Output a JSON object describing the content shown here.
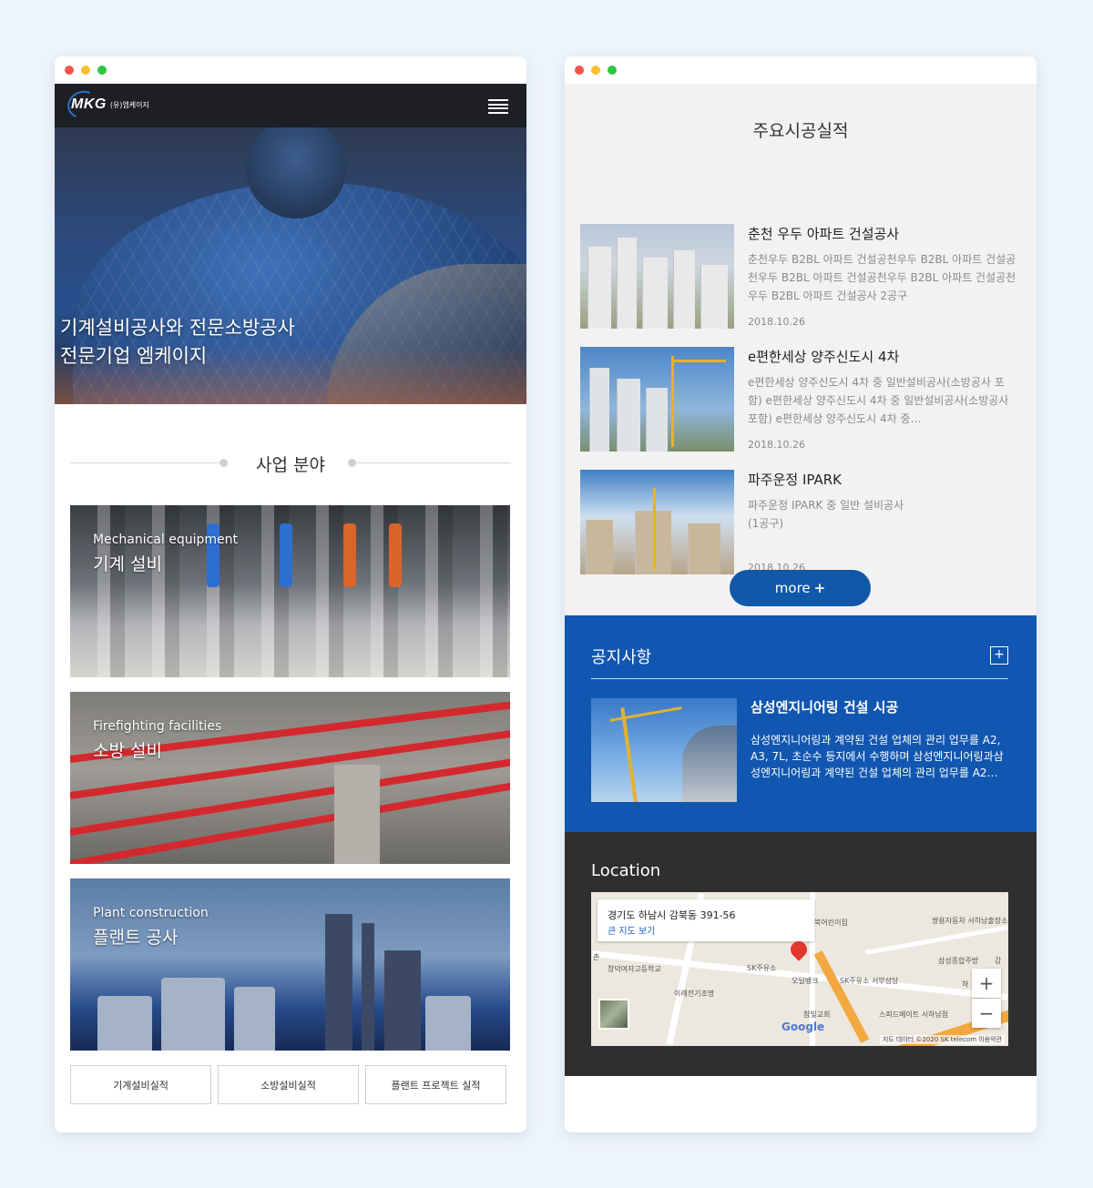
{
  "left": {
    "logo": {
      "mark": "MKG",
      "sub": "(유)엠케이지"
    },
    "hero_title_lines": [
      "기계설비공사와 전문소방공사",
      "전문기업 엠케이지"
    ],
    "biz_heading": "사업 분야",
    "cards": [
      {
        "en": "Mechanical equipment",
        "ko": "기계 설비"
      },
      {
        "en": "Firefighting facilities",
        "ko": "소방 설비"
      },
      {
        "en": "Plant construction",
        "ko": "플랜트 공사"
      }
    ],
    "buttons": [
      "기계설비실적",
      "소방설비실적",
      "플랜트 프로젝트 실적"
    ]
  },
  "right": {
    "section_title": "주요시공실적",
    "projects": [
      {
        "title": "춘천 우두 아파트 건설공사",
        "desc": "춘천우두 B2BL 아파트 건설공천우두 B2BL 아파트 건설공천우두 B2BL 아파트 건설공천우두 B2BL 아파트 건설공천우두 B2BL 아파트 건설공사 2공구",
        "date": "2018.10.26"
      },
      {
        "title": "e편한세상 양주신도시 4차",
        "desc": "e편한세상 양주신도시 4차 중 일반설비공사(소방공사 포함) e편한세상 양주신도시 4차 중 일반설비공사(소방공사 포함) e편한세상 양주신도시 4차 중…",
        "date": "2018.10.26"
      },
      {
        "title": "파주운정 IPARK",
        "desc": "파주운정 IPARK 중 일반 설비공사\n(1공구)",
        "date": "2018.10.26"
      }
    ],
    "more_label": "more",
    "more_plus": "+",
    "notice": {
      "heading": "공지사항",
      "plus": "+",
      "title": "삼성엔지니어링 건설 시공",
      "desc": "삼성엔지니어링과 계약된 건설 업체의 관리 업무를 A2, A3, 7L, 초순수 등지에서 수행하며 삼성엔지니어링과삼성엔지니어링과 계약된 건설 업체의 관리 업무를 A2…"
    },
    "location": {
      "heading": "Location",
      "address": "경기도 하남시 감북동 391-56",
      "bigmap_link": "큰 지도 보기",
      "zoom_in": "+",
      "zoom_out": "−",
      "google": "Google",
      "credit": "지도 데이터 ©2020 SK telecom   이용약관",
      "labels": [
        "북어린이집",
        "쌍용자동차 서하남출장소",
        "삼성종합주방",
        "창덕여자고등학교",
        "SK주유소",
        "오일뱅크",
        "SK주유소 서부성당",
        "이례전기조명",
        "참빛교회",
        "스피드메이트 서하남점",
        "하",
        "감",
        "촌"
      ]
    }
  }
}
